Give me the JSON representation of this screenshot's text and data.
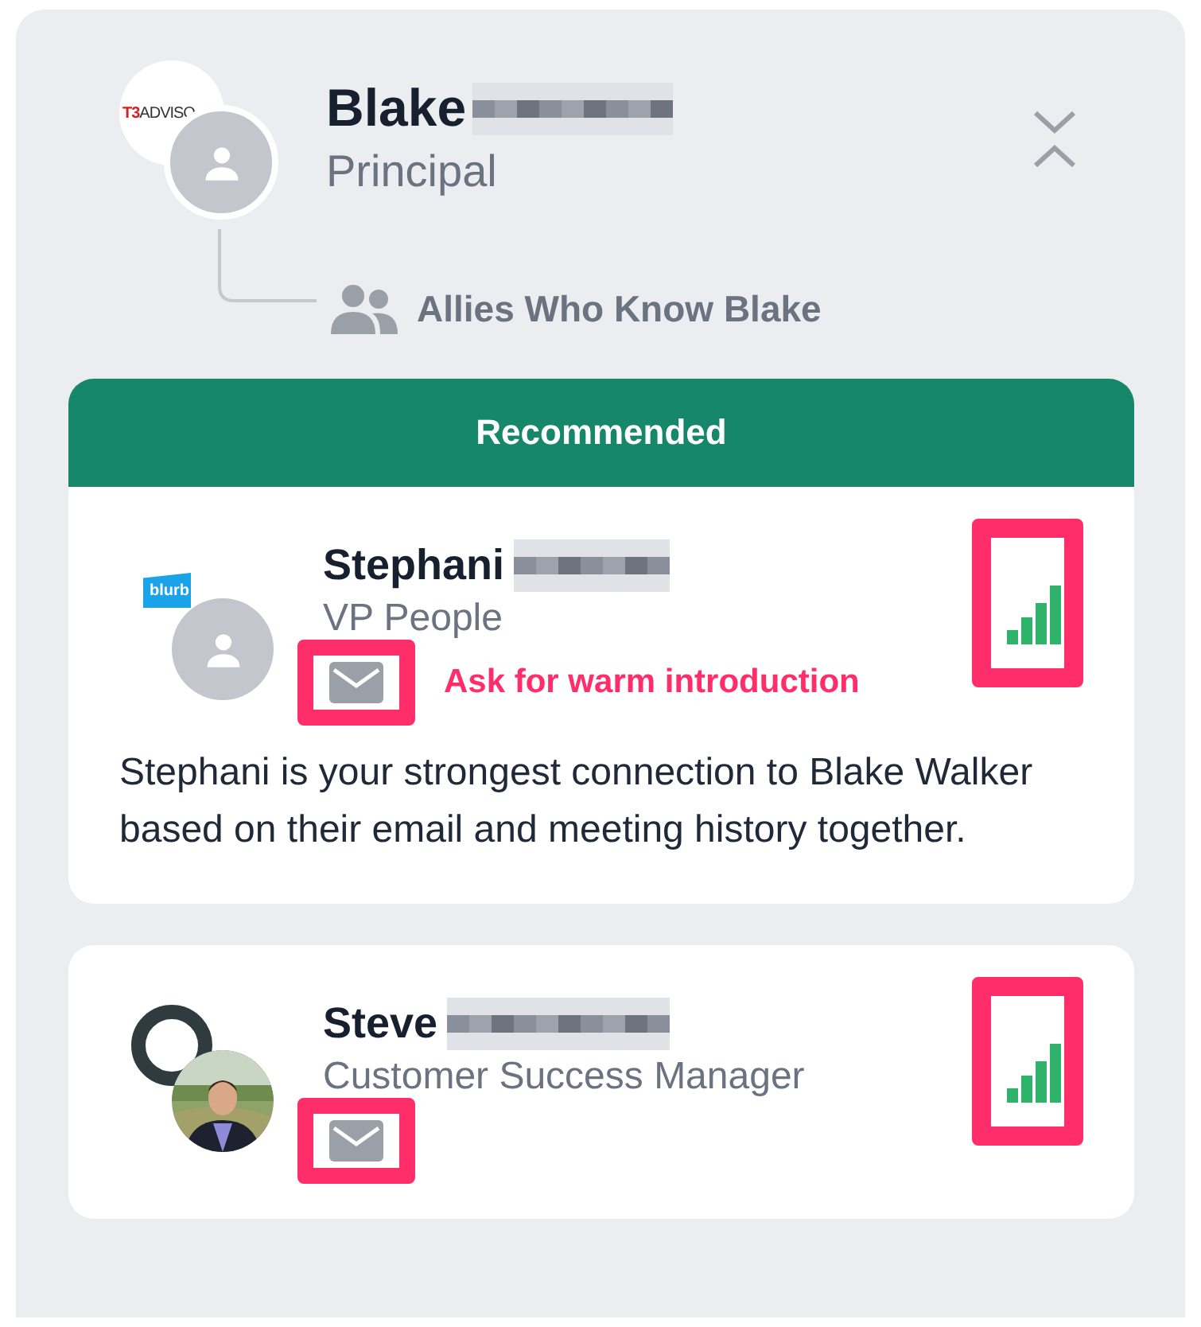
{
  "contact": {
    "logo": {
      "kind": "text",
      "text": "T3ADVISO"
    },
    "avatar": {
      "kind": "placeholder"
    },
    "name": "Blake",
    "title": "Principal"
  },
  "allies_label": "Allies Who Know Blake",
  "recommended": {
    "label": "Recommended",
    "ally": {
      "logo": {
        "kind": "speech",
        "text": "blurb"
      },
      "avatar": {
        "kind": "placeholder"
      },
      "name": "Stephani",
      "title": "VP People",
      "annotation": "Ask for warm introduction",
      "description": "Stephani is your strongest connection to Blake Walker based on their email and meeting history together."
    }
  },
  "allies": [
    {
      "logo": {
        "kind": "ring"
      },
      "name": "Steve",
      "title": "Customer Success Manager"
    }
  ]
}
